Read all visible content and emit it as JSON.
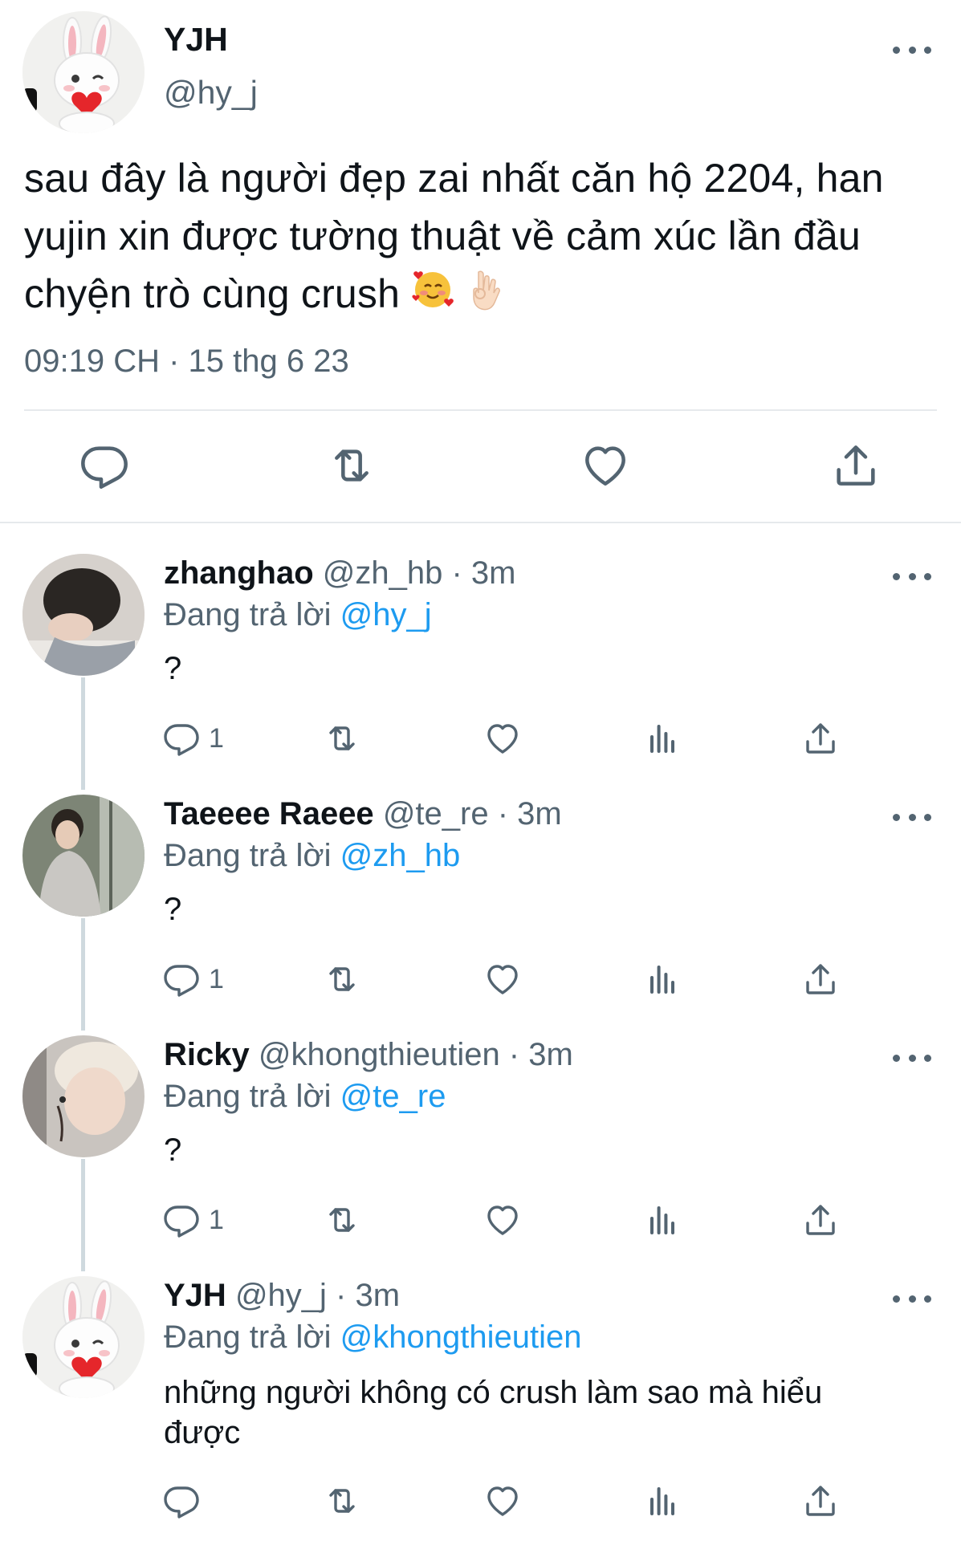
{
  "tweet": {
    "author_name": "YJH",
    "author_handle": "@hy_j",
    "text": "sau đây là người đẹp zai nhất căn hộ 2204, han yujin xin được tường thuật về cảm xúc lần đầu chyện trò cùng crush",
    "emojis": [
      "🥰",
      "👌"
    ],
    "timestamp": "09:19 CH · 15 thg 6 23"
  },
  "replies": [
    {
      "name": "zhanghao",
      "meta": "@zh_hb · 3m",
      "replying_label": "Đang trả lời",
      "replying_to": "@hy_j",
      "text": "?",
      "reply_count": "1"
    },
    {
      "name": "Taeeee Raeee",
      "meta": "@te_re · 3m",
      "replying_label": "Đang trả lời",
      "replying_to": "@zh_hb",
      "text": "?",
      "reply_count": "1"
    },
    {
      "name": "Ricky",
      "meta": "@khongthieutien · 3m",
      "replying_label": "Đang trả lời",
      "replying_to": "@te_re",
      "text": "?",
      "reply_count": "1"
    },
    {
      "name": "YJH",
      "meta": "@hy_j · 3m",
      "replying_label": "Đang trả lời",
      "replying_to": "@khongthieutien",
      "text": "những người không có crush làm sao mà hiểu được",
      "reply_count": ""
    }
  ],
  "colors": {
    "text_primary": "#0f1419",
    "text_secondary": "#536471",
    "link": "#1d9bf0",
    "divider": "#e6e9ec",
    "thread_line": "#cfd9de"
  },
  "icons": [
    "reply-icon",
    "retweet-icon",
    "like-icon",
    "share-icon",
    "views-icon",
    "more-icon"
  ]
}
